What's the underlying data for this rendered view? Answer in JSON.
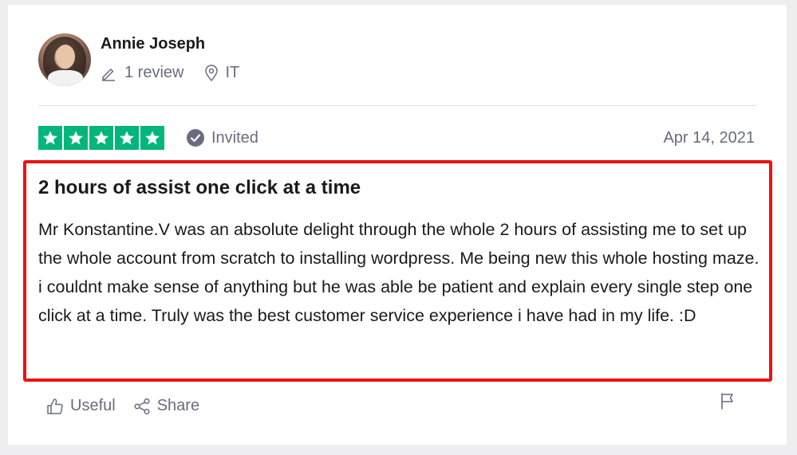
{
  "reviewer": {
    "name": "Annie Joseph",
    "review_count": "1 review",
    "location": "IT",
    "avatar_icon": "reviewer-photo"
  },
  "rating": {
    "stars": 5,
    "max_stars": 5,
    "star_color": "#00b67a",
    "invited_label": "Invited",
    "date": "Apr 14, 2021"
  },
  "review": {
    "title": "2 hours of assist one click at a time",
    "body": "Mr Konstantine.V was an absolute delight through the whole 2 hours of assisting me to set up the whole account from scratch to installing wordpress. Me being new this whole hosting maze. i couldnt make sense of anything but he was able be patient and explain every single step one click at a time. Truly was the best customer service experience i have had in my life. :D"
  },
  "actions": {
    "useful_label": "Useful",
    "share_label": "Share",
    "flag_icon": "flag-icon"
  },
  "colors": {
    "highlight_border": "#ee1111",
    "muted_text": "#6b6b80",
    "brand_green": "#00b67a"
  }
}
